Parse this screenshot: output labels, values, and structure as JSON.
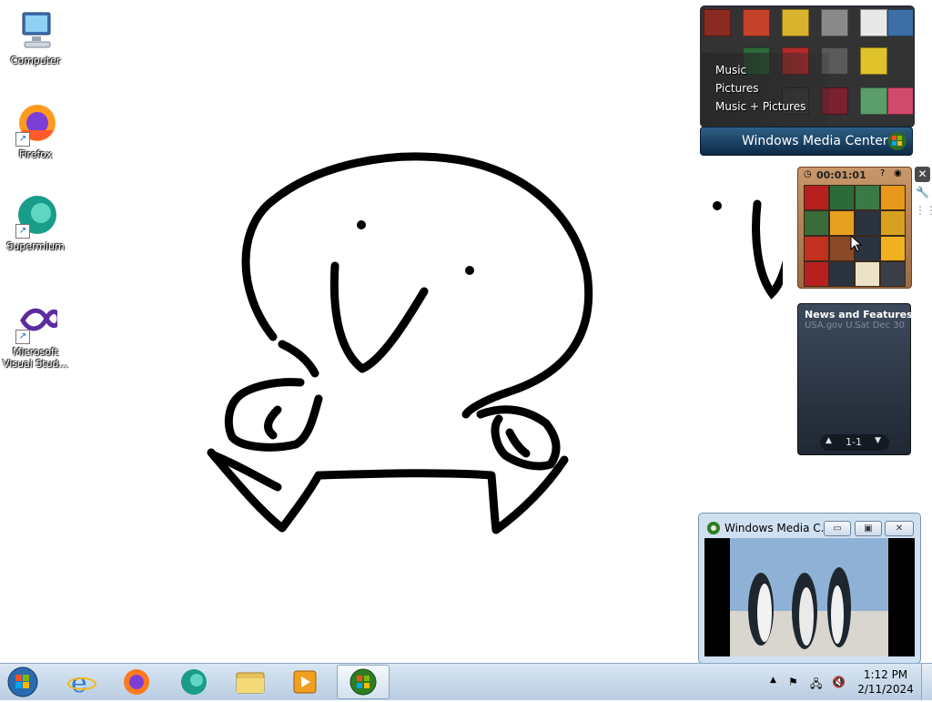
{
  "desktop": {
    "icons": [
      {
        "label": "Computer",
        "icon": "computer-icon"
      },
      {
        "label": "Firefox",
        "icon": "firefox-icon"
      },
      {
        "label": "Supermium",
        "icon": "supermium-icon"
      },
      {
        "label": "Microsoft Visual Stud...",
        "icon": "visual-studio-icon"
      }
    ]
  },
  "media_center_gadget": {
    "menu": [
      "Music",
      "Pictures",
      "Music + Pictures"
    ],
    "banner_label": "Windows Media Center"
  },
  "puzzle_gadget": {
    "timer": "00:01:01"
  },
  "news_gadget": {
    "headline": "News and Features f...",
    "source": "USA.gov U...",
    "date": "Sat Dec 30",
    "pager": "1-1"
  },
  "video_window": {
    "title": "Windows Media C..."
  },
  "taskbar": {
    "items": [
      "start-button",
      "internet-explorer-icon",
      "firefox-icon",
      "supermium-icon",
      "file-explorer-icon",
      "media-player-icon",
      "windows-media-center-icon"
    ],
    "clock_time": "1:12 PM",
    "clock_date": "2/11/2024"
  },
  "colors": {
    "desktop_background": "#ffffff",
    "taskbar": "#c4d6e9",
    "wmc_banner": "#1d4468"
  }
}
